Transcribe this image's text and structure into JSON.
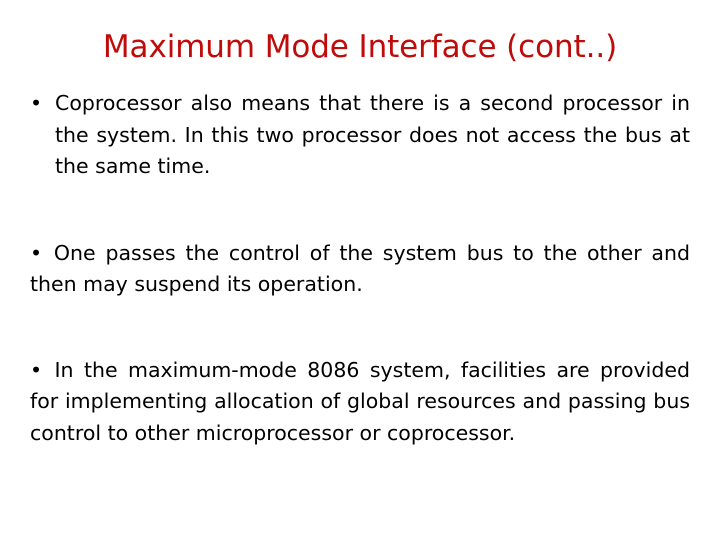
{
  "slide": {
    "title": "Maximum Mode Interface (cont..)",
    "title_color": "#C00B0B",
    "body_color": "#000000",
    "background_color": "#FFFFFF",
    "bullet_glyph": "•",
    "paragraphs": [
      {
        "bullet": "•",
        "style": "hanging",
        "text": "Coprocessor also means that there is a second processor in the system. In this two processor does not access the bus at the same time."
      },
      {
        "bullet": "•",
        "style": "flush",
        "text": "One passes the control of the system bus to the other and then may suspend its operation."
      },
      {
        "bullet": "•",
        "style": "flush",
        "text": "In the maximum-mode 8086 system, facilities are provided for implementing allocation of global resources and passing bus control to other microprocessor or coprocessor."
      }
    ]
  }
}
